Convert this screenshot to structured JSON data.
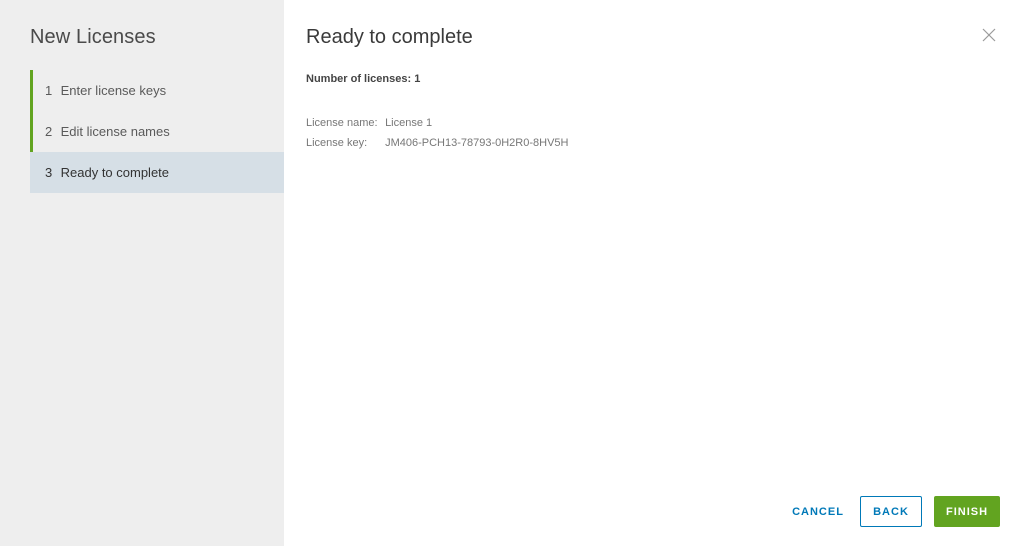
{
  "sidebar": {
    "title": "New Licenses",
    "steps": [
      {
        "number": "1",
        "label": "Enter license keys",
        "state": "done"
      },
      {
        "number": "2",
        "label": "Edit license names",
        "state": "done"
      },
      {
        "number": "3",
        "label": "Ready to complete",
        "state": "current"
      }
    ]
  },
  "main": {
    "title": "Ready to complete",
    "summary": "Number of licenses: 1",
    "details": [
      {
        "label": "License name:",
        "value": "License 1"
      },
      {
        "label": "License key:",
        "value": "JM406-PCH13-78793-0H2R0-8HV5H"
      }
    ]
  },
  "footer": {
    "cancel_label": "CANCEL",
    "back_label": "BACK",
    "finish_label": "FINISH"
  },
  "icons": {
    "close": "close-icon"
  },
  "colors": {
    "accent_green": "#62a420",
    "link_blue": "#0079b8",
    "sidebar_bg": "#eeeeee",
    "current_step_bg": "#d6dfe6"
  }
}
